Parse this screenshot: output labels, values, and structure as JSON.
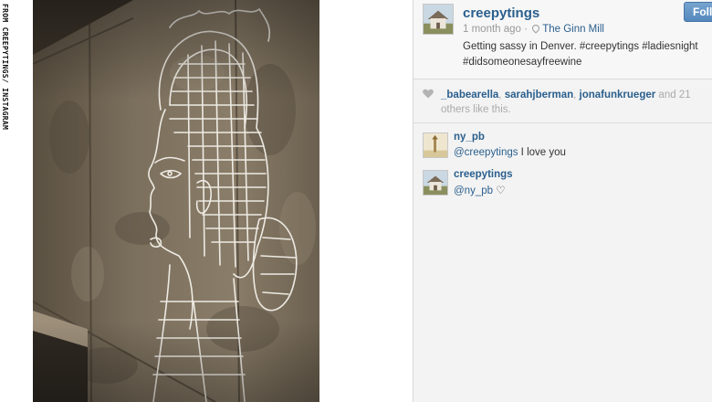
{
  "credit": "FROM CREEPYTINGS/ INSTAGRAM",
  "post": {
    "username": "creepytings",
    "follow_label": "Follow",
    "time": "1 month ago",
    "location": "The Ginn Mill",
    "separator": "·",
    "caption": "Getting sassy in Denver. #creepytings #ladiesnight #didsomeonesayfreewine"
  },
  "likes": {
    "names": [
      "_babearella",
      "sarahjberman",
      "jonafunkrueger"
    ],
    "sep1": ", ",
    "sep2": ", ",
    "suffix": " and 21 others like this."
  },
  "comments": [
    {
      "user": "ny_pb",
      "mention": "@creepytings",
      "text": " I love you"
    },
    {
      "user": "creepytings",
      "mention": "@ny_pb",
      "text": " ♡"
    }
  ],
  "icons": {
    "like": "heart-icon",
    "location": "pin-icon"
  },
  "colors": {
    "link": "#2a5f8d",
    "follow_button": "#5488bd",
    "panel_bg": "#f3f3f3"
  }
}
